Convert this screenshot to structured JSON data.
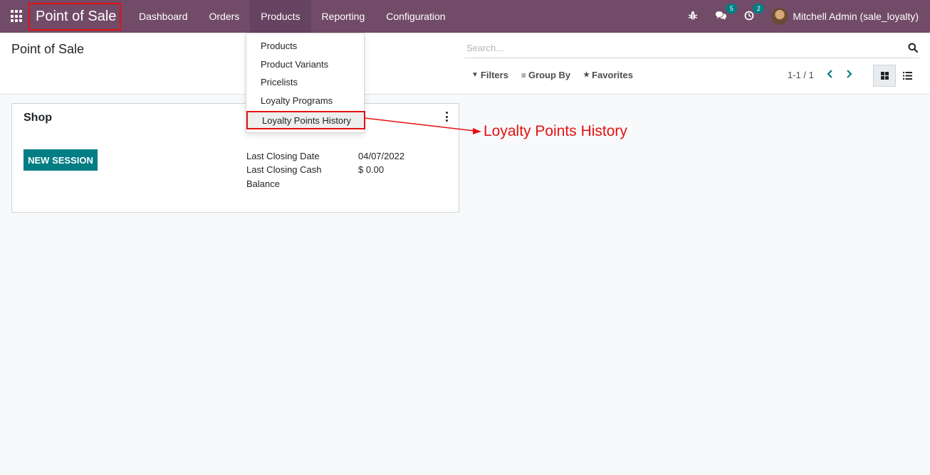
{
  "navbar": {
    "brand": "Point of Sale",
    "menu": [
      "Dashboard",
      "Orders",
      "Products",
      "Reporting",
      "Configuration"
    ],
    "active_menu": "Products",
    "messages_badge": "5",
    "activities_badge": "2",
    "user": "Mitchell Admin (sale_loyalty)"
  },
  "control_panel": {
    "title": "Point of Sale",
    "search_placeholder": "Search...",
    "filters_label": "Filters",
    "groupby_label": "Group By",
    "favorites_label": "Favorites",
    "pager": "1-1 / 1"
  },
  "dropdown": {
    "items": [
      "Products",
      "Product Variants",
      "Pricelists",
      "Loyalty Programs",
      "Loyalty Points History"
    ],
    "highlighted": "Loyalty Points History"
  },
  "card": {
    "title": "Shop",
    "button_label": "NEW SESSION",
    "stats": [
      {
        "label": "Last Closing Date",
        "value": "04/07/2022"
      },
      {
        "label": "Last Closing Cash Balance",
        "value": "$ 0.00"
      }
    ]
  },
  "annotation": {
    "text": "Loyalty Points History",
    "color": "#e31212"
  },
  "colors": {
    "navbar": "#714b67",
    "accent": "#017e84",
    "highlight": "#e31212"
  }
}
